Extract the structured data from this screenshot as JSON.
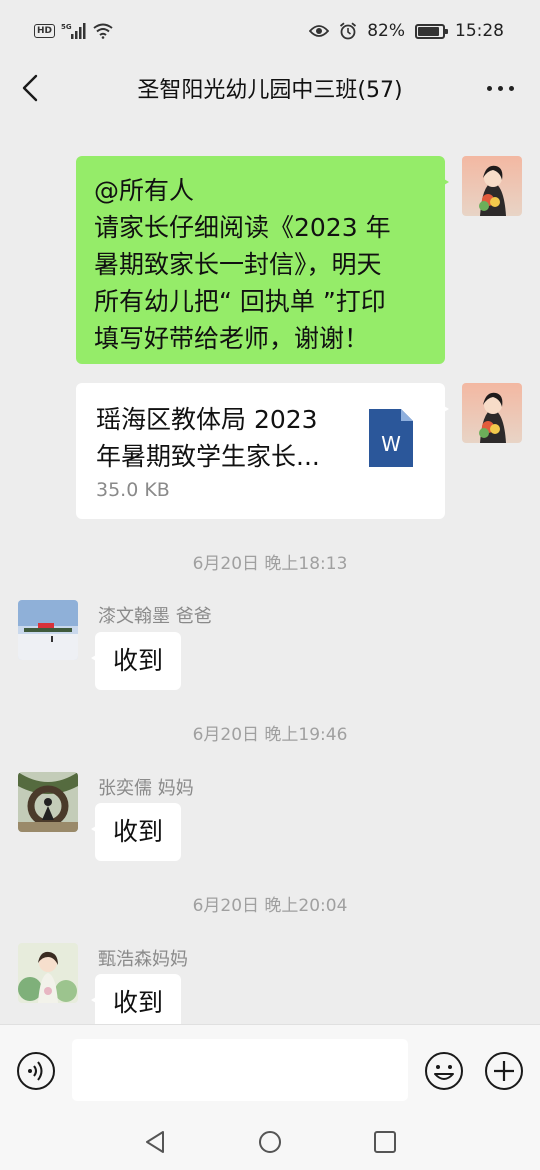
{
  "status": {
    "network": "5G",
    "battery": "82%",
    "time": "15:28"
  },
  "header": {
    "title": "圣智阳光幼儿园中三班(57)"
  },
  "messages": {
    "own_text": {
      "lines": [
        "@所有人",
        "请家长仔细阅读《2023 年",
        "暑期致家长一封信》，明天",
        "所有幼儿把“ 回执单 ”打印",
        "填写好带给老师，谢谢！"
      ]
    },
    "own_file": {
      "name_lines": [
        "瑶海区教体局 2023",
        "年暑期致学生家长..."
      ],
      "size": "35.0 KB",
      "icon": "word-doc-icon",
      "icon_letter": "W"
    },
    "items": [
      {
        "time": "6月20日 晚上18:13",
        "sender": "漆文翰墨  爸爸",
        "text": "收到"
      },
      {
        "time": "6月20日 晚上19:46",
        "sender": "张奕儒  妈妈",
        "text": "收到"
      },
      {
        "time": "6月20日 晚上20:04",
        "sender": "甄浩森妈妈",
        "text": "收到"
      }
    ]
  },
  "input": {
    "placeholder": ""
  },
  "colors": {
    "own_bubble": "#95ec69",
    "background": "#ededed",
    "word_blue": "#2b579a"
  }
}
